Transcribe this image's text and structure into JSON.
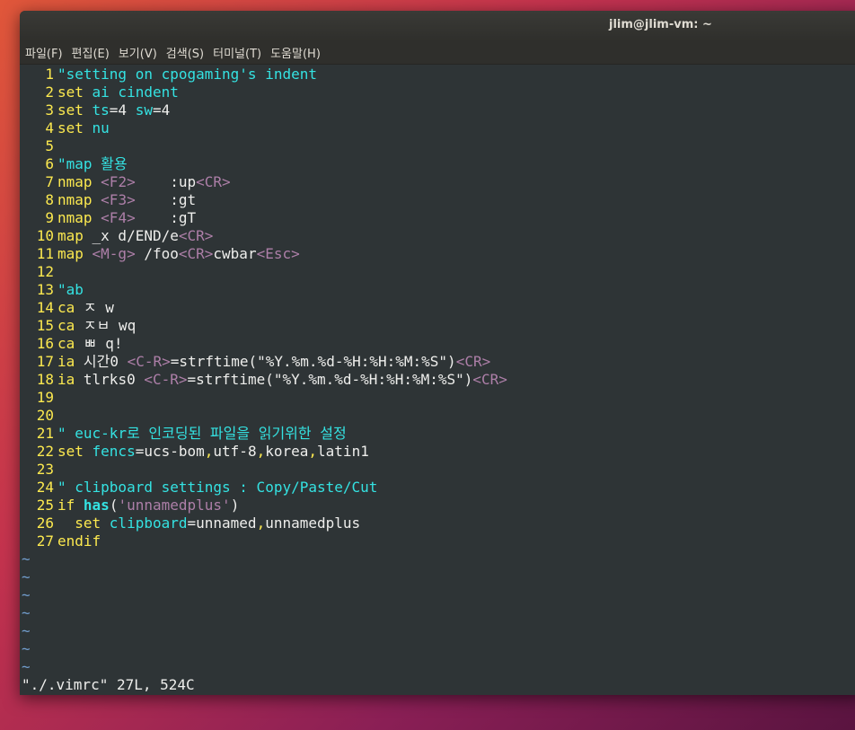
{
  "window": {
    "title": "jlim@jlim-vm: ~"
  },
  "menu": [
    "파일(F)",
    "편집(E)",
    "보기(V)",
    "검색(S)",
    "터미널(T)",
    "도움말(H)"
  ],
  "lines": [
    {
      "n": "1",
      "segs": [
        [
          "\"setting on cpogaming's indent",
          "c"
        ]
      ]
    },
    {
      "n": "2",
      "segs": [
        [
          "set ",
          "k"
        ],
        [
          "ai cindent",
          "id"
        ]
      ]
    },
    {
      "n": "3",
      "segs": [
        [
          "set ",
          "k"
        ],
        [
          "ts",
          "id"
        ],
        [
          "=4 ",
          "n"
        ],
        [
          "sw",
          "id"
        ],
        [
          "=4",
          "n"
        ]
      ]
    },
    {
      "n": "4",
      "segs": [
        [
          "set ",
          "k"
        ],
        [
          "nu",
          "id"
        ]
      ]
    },
    {
      "n": "5",
      "segs": []
    },
    {
      "n": "6",
      "segs": [
        [
          "\"map 활용",
          "c"
        ]
      ]
    },
    {
      "n": "7",
      "segs": [
        [
          "nmap ",
          "k"
        ],
        [
          "<F2>",
          "sp"
        ],
        [
          "    :up",
          "n"
        ],
        [
          "<CR>",
          "sp"
        ]
      ]
    },
    {
      "n": "8",
      "segs": [
        [
          "nmap ",
          "k"
        ],
        [
          "<F3>",
          "sp"
        ],
        [
          "    :gt",
          "n"
        ]
      ]
    },
    {
      "n": "9",
      "segs": [
        [
          "nmap ",
          "k"
        ],
        [
          "<F4>",
          "sp"
        ],
        [
          "    :gT",
          "n"
        ]
      ]
    },
    {
      "n": "10",
      "segs": [
        [
          "map ",
          "k"
        ],
        [
          "_x d/END/e",
          "n"
        ],
        [
          "<CR>",
          "sp"
        ]
      ]
    },
    {
      "n": "11",
      "segs": [
        [
          "map ",
          "k"
        ],
        [
          "<M-g>",
          "sp"
        ],
        [
          " /foo",
          "n"
        ],
        [
          "<CR>",
          "sp"
        ],
        [
          "cwbar",
          "n"
        ],
        [
          "<Esc>",
          "sp"
        ]
      ]
    },
    {
      "n": "12",
      "segs": []
    },
    {
      "n": "13",
      "segs": [
        [
          "\"ab",
          "c"
        ]
      ]
    },
    {
      "n": "14",
      "segs": [
        [
          "ca ",
          "k"
        ],
        [
          "ㅈ w",
          "n"
        ]
      ]
    },
    {
      "n": "15",
      "segs": [
        [
          "ca ",
          "k"
        ],
        [
          "ㅈㅂ wq",
          "n"
        ]
      ]
    },
    {
      "n": "16",
      "segs": [
        [
          "ca ",
          "k"
        ],
        [
          "ㅃ q!",
          "n"
        ]
      ]
    },
    {
      "n": "17",
      "segs": [
        [
          "ia ",
          "k"
        ],
        [
          "시간0 ",
          "n"
        ],
        [
          "<C-R>",
          "sp"
        ],
        [
          "=strftime(\"%Y.%m.%d-%H:%H:%M:%S\")",
          "n"
        ],
        [
          "<CR>",
          "sp"
        ]
      ]
    },
    {
      "n": "18",
      "segs": [
        [
          "ia ",
          "k"
        ],
        [
          "tlrks0 ",
          "n"
        ],
        [
          "<C-R>",
          "sp"
        ],
        [
          "=strftime(\"%Y.%m.%d-%H:%H:%M:%S\")",
          "n"
        ],
        [
          "<CR>",
          "sp"
        ]
      ]
    },
    {
      "n": "19",
      "segs": []
    },
    {
      "n": "20",
      "segs": []
    },
    {
      "n": "21",
      "segs": [
        [
          "\" euc-kr로 인코딩된 파일을 읽기위한 설정",
          "c"
        ]
      ]
    },
    {
      "n": "22",
      "segs": [
        [
          "set ",
          "k"
        ],
        [
          "fencs",
          "id"
        ],
        [
          "=ucs-bom",
          "n"
        ],
        [
          ",",
          "k"
        ],
        [
          "utf-8",
          "n"
        ],
        [
          ",",
          "k"
        ],
        [
          "korea",
          "n"
        ],
        [
          ",",
          "k"
        ],
        [
          "latin1",
          "n"
        ]
      ]
    },
    {
      "n": "23",
      "segs": []
    },
    {
      "n": "24",
      "segs": [
        [
          "\" clipboard settings : Copy/Paste/Cut",
          "c"
        ]
      ]
    },
    {
      "n": "25",
      "segs": [
        [
          "if ",
          "k"
        ],
        [
          "has",
          "b"
        ],
        [
          "(",
          "n"
        ],
        [
          "'unnamedplus'",
          "s"
        ],
        [
          ")",
          "n"
        ]
      ]
    },
    {
      "n": "26",
      "segs": [
        [
          "  set ",
          "k"
        ],
        [
          "clipboard",
          "id"
        ],
        [
          "=unnamed",
          "n"
        ],
        [
          ",",
          "k"
        ],
        [
          "unnamedplus",
          "n"
        ]
      ]
    },
    {
      "n": "27",
      "segs": [
        [
          "endif",
          "k"
        ]
      ]
    }
  ],
  "tildes": [
    "~",
    "~",
    "~",
    "~",
    "~",
    "~",
    "~"
  ],
  "status": "\"./.vimrc\" 27L, 524C"
}
